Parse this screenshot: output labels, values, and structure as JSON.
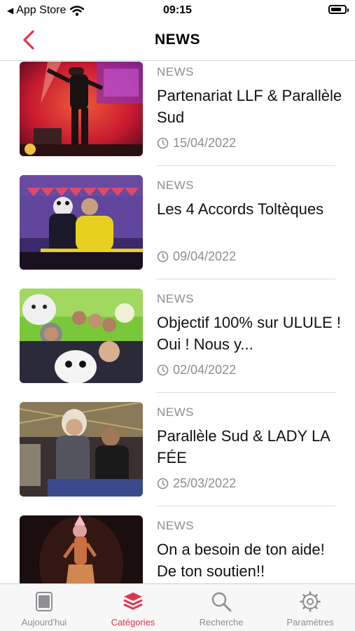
{
  "status_bar": {
    "back_app": "App Store",
    "time": "09:15",
    "battery_level": 0.75
  },
  "nav": {
    "title": "NEWS"
  },
  "items": [
    {
      "category": "NEWS",
      "title": "Partenariat LLF & Parallèle Sud",
      "date": "15/04/2022"
    },
    {
      "category": "NEWS",
      "title": "Les 4 Accords Toltèques",
      "date": "09/04/2022"
    },
    {
      "category": "NEWS",
      "title": "Objectif 100% sur ULULE ! Oui ! Nous y...",
      "date": "02/04/2022"
    },
    {
      "category": "NEWS",
      "title": "Parallèle Sud & LADY LA FÉE",
      "date": "25/03/2022"
    },
    {
      "category": "NEWS",
      "title": "On a besoin de ton aide! De ton soutien!!",
      "date": ""
    }
  ],
  "tabs": [
    {
      "label": "Aujourd'hui"
    },
    {
      "label": "Catégories"
    },
    {
      "label": "Recherche"
    },
    {
      "label": "Paramètres"
    }
  ],
  "colors": {
    "accent": "#e0344d",
    "inactive": "#8e8e93"
  }
}
